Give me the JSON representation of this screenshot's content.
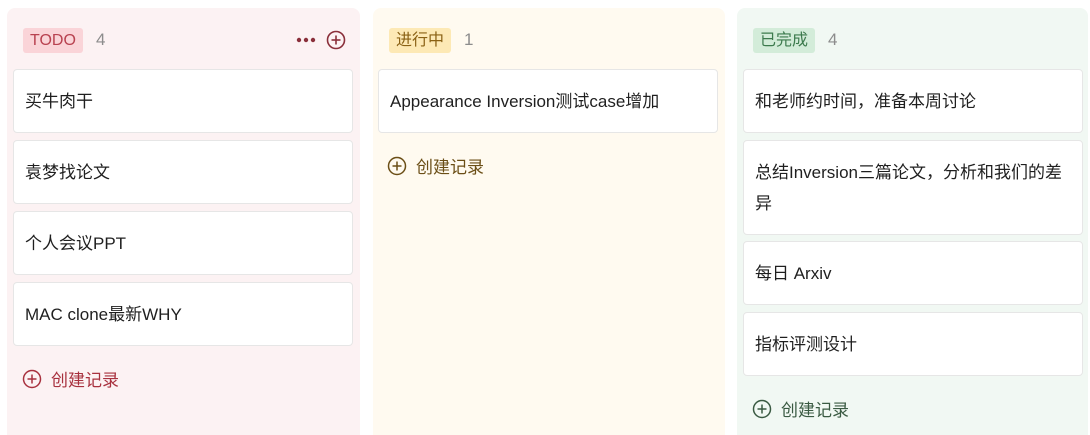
{
  "columns": [
    {
      "status": "TODO",
      "count": "4",
      "cards": [
        "买牛肉干",
        "袁梦找论文",
        "个人会议PPT",
        "MAC clone最新WHY"
      ],
      "add_label": "创建记录"
    },
    {
      "status": "进行中",
      "count": "1",
      "cards": [
        "Appearance Inversion测试case增加"
      ],
      "add_label": "创建记录"
    },
    {
      "status": "已完成",
      "count": "4",
      "cards": [
        "和老师约时间，准备本周讨论",
        "总结Inversion三篇论文，分析和我们的差异",
        "每日 Arxiv",
        "指标评测设计"
      ],
      "add_label": "创建记录"
    }
  ],
  "icons": {
    "more": "more-icon",
    "add_column": "plus-circle-icon",
    "add_record": "plus-circle-icon"
  },
  "colors": {
    "todo_accent": "#b8414f",
    "progress_accent": "#8a6114",
    "done_accent": "#3c7a4d"
  }
}
